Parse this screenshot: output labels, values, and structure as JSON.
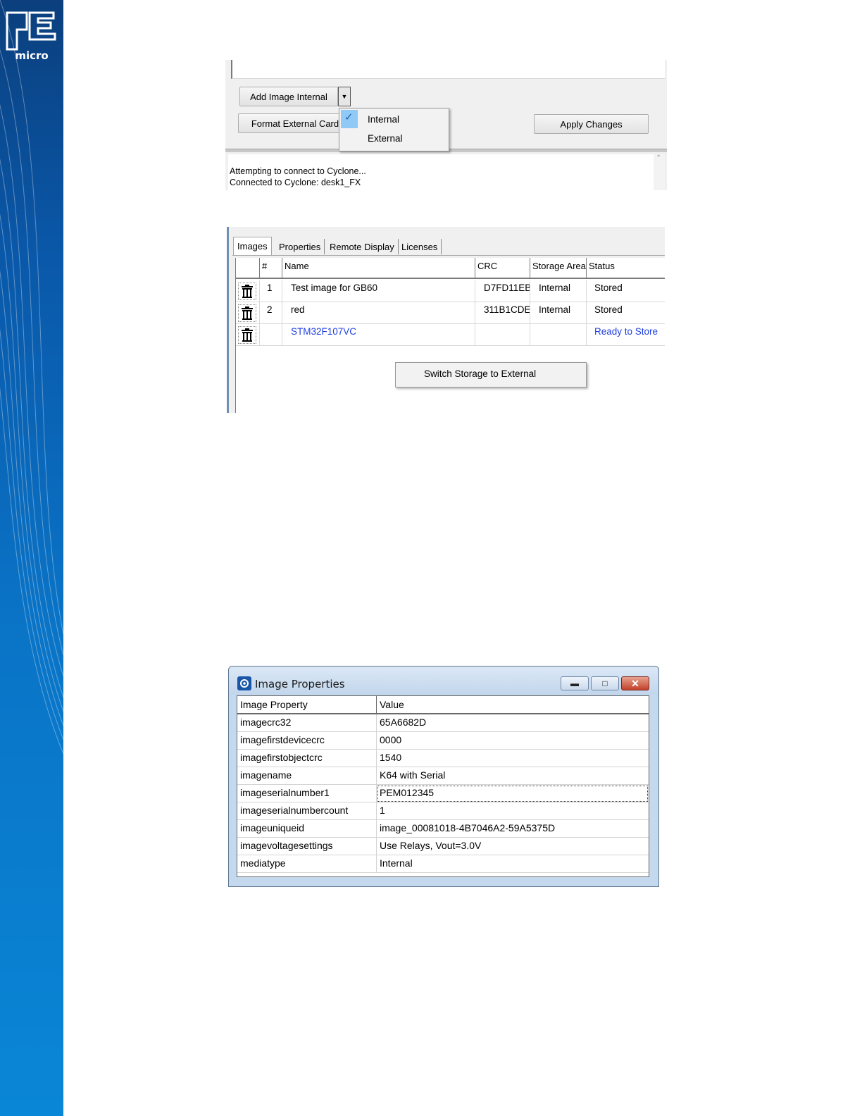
{
  "brand": {
    "logo_text": "PE micro",
    "strip_color": "#0a73c6"
  },
  "shot1": {
    "add_image_label": "Add Image Internal",
    "dropdown_icon": "chevron-down-icon",
    "format_label": "Format External Card",
    "apply_label": "Apply Changes",
    "storage_menu": {
      "items": [
        {
          "label": "Internal",
          "checked": true
        },
        {
          "label": "External",
          "checked": false
        }
      ]
    },
    "log": [
      "Attempting to connect to Cyclone...",
      "Connected to Cyclone: desk1_FX"
    ]
  },
  "shot2": {
    "tabs": [
      "Images",
      "Properties",
      "Remote Display",
      "Licenses"
    ],
    "columns": [
      "",
      "#",
      "Name",
      "CRC",
      "Storage Area",
      "Status"
    ],
    "rows": [
      {
        "num": "1",
        "name": "Test image for GB60",
        "crc": "D7FD11EB",
        "storage": "Internal",
        "status": "Stored"
      },
      {
        "num": "2",
        "name": "red",
        "crc": "311B1CDE",
        "storage": "Internal",
        "status": "Stored"
      },
      {
        "num": "",
        "name": "STM32F107VC",
        "crc": "",
        "storage": "",
        "status": "Ready to Store"
      }
    ],
    "context_menu": "Switch Storage to External",
    "pending_color": "#1f3fe0"
  },
  "dialog": {
    "title": "Image Properties",
    "columns": [
      "Image Property",
      "Value"
    ],
    "rows": [
      [
        "imagecrc32",
        "65A6682D"
      ],
      [
        "imagefirstdevicecrc",
        "0000"
      ],
      [
        "imagefirstobjectcrc",
        "1540"
      ],
      [
        "imagename",
        "K64 with Serial"
      ],
      [
        "imageserialnumber1",
        "PEM012345"
      ],
      [
        "imageserialnumbercount",
        "1"
      ],
      [
        "imageuniqueid",
        "image_00081018-4B7046A2-59A5375D"
      ],
      [
        "imagevoltagesettings",
        "Use Relays, Vout=3.0V"
      ],
      [
        "mediatype",
        "Internal"
      ]
    ]
  }
}
